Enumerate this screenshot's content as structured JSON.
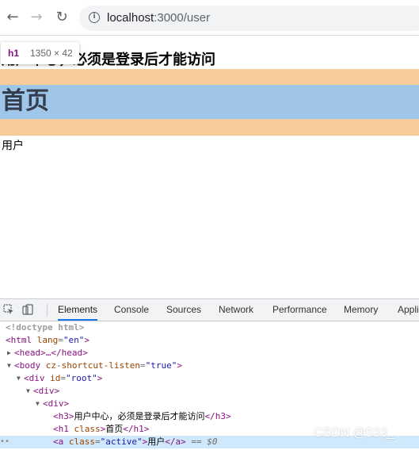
{
  "browser": {
    "back_icon": "←",
    "forward_icon": "→",
    "reload_icon": "↻",
    "info_icon": "i",
    "url_host": "localhost",
    "url_path": ":3000/user"
  },
  "page": {
    "h3_text": "用户中心，必须是登录后才能访问",
    "h1_text": "首页",
    "link_text": "用户",
    "tooltip_tag": "h1",
    "tooltip_size": "1350 × 42"
  },
  "devtools": {
    "tabs": [
      "Elements",
      "Console",
      "Sources",
      "Network",
      "Performance",
      "Memory",
      "Appli"
    ],
    "active_tab": "Elements",
    "dom": {
      "doctype": "<!doctype html>",
      "html_open": "<html",
      "html_attr": "lang",
      "html_val": "\"en\"",
      "head": "<head>…</head>",
      "body_open": "<body",
      "body_attr": "cz-shortcut-listen",
      "body_val": "\"true\"",
      "div_root_open": "<div",
      "div_root_attr": "id",
      "div_root_val": "\"root\"",
      "div_open": "<div>",
      "h3_open": "<h3>",
      "h3_text": "用户中心，必须是登录后才能访问",
      "h3_close": "</h3>",
      "h1_open": "<h1",
      "h1_attr": "class",
      "h1_text": "首页",
      "h1_close": "</h1>",
      "a_open": "<a",
      "a_attr": "class",
      "a_val": "\"active\"",
      "a_text": "用户",
      "a_close": "</a>",
      "sel_marker": "== $0"
    }
  },
  "watermark": "CSDN @533_"
}
